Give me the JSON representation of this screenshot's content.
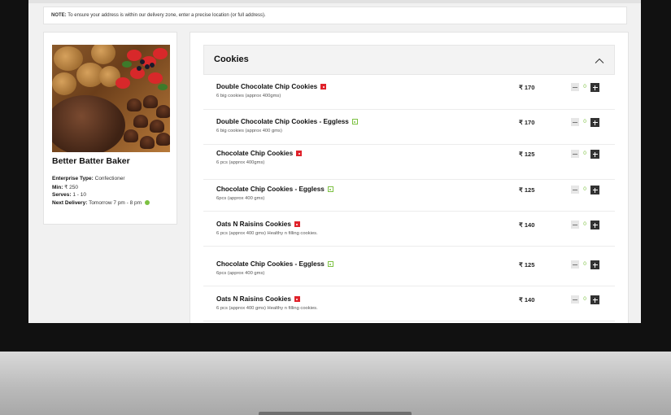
{
  "note": {
    "prefix": "NOTE:",
    "text": "To ensure your address is within our delivery zone, enter a precise location (or full address)."
  },
  "baker": {
    "name": "Better Batter Baker",
    "enterprise_label": "Enterprise Type:",
    "enterprise_value": "Confectioner",
    "min_label": "Min:",
    "min_value": "₹ 250",
    "serves_label": "Serves:",
    "serves_value": "1 - 10",
    "next_delivery_label": "Next Delivery:",
    "next_delivery_value": "Tomorrow 7 pm - 8 pm"
  },
  "section": {
    "title": "Cookies",
    "chevron": "chevron-up-icon"
  },
  "items": [
    {
      "name": "Double Chocolate Chip Cookies",
      "desc": "6 big cookies (approx 400gms)",
      "price": "₹ 170",
      "qty": "0",
      "type": "nonveg"
    },
    {
      "name": "Double Chocolate Chip Cookies - Eggless",
      "desc": "6 big cookies (approx 400 gms)",
      "price": "₹ 170",
      "qty": "0",
      "type": "veg"
    },
    {
      "name": "Chocolate Chip Cookies",
      "desc": "6 pcs (approx 400gms)",
      "price": "₹ 125",
      "qty": "0",
      "type": "nonveg"
    },
    {
      "name": "Chocolate Chip Cookies - Eggless",
      "desc": "6pcs (approx 400 gms)",
      "price": "₹ 125",
      "qty": "0",
      "type": "veg"
    },
    {
      "name": "Oats N Raisins Cookies",
      "desc": "6 pcs (approx 400 gms) Healthy n filling cookies.",
      "price": "₹ 140",
      "qty": "0",
      "type": "nonveg"
    },
    {
      "name": "Chocolate Chip Cookies - Eggless",
      "desc": "6pcs (approx 400 gms)",
      "price": "₹ 125",
      "qty": "0",
      "type": "veg"
    },
    {
      "name": "Oats N Raisins Cookies",
      "desc": "6 pcs (approx 400 gms) Healthy n filling cookies.",
      "price": "₹ 140",
      "qty": "0",
      "type": "nonveg"
    }
  ],
  "colors": {
    "veg": "#7cc142",
    "nonveg": "#e0222b",
    "bezel": "#111111"
  }
}
